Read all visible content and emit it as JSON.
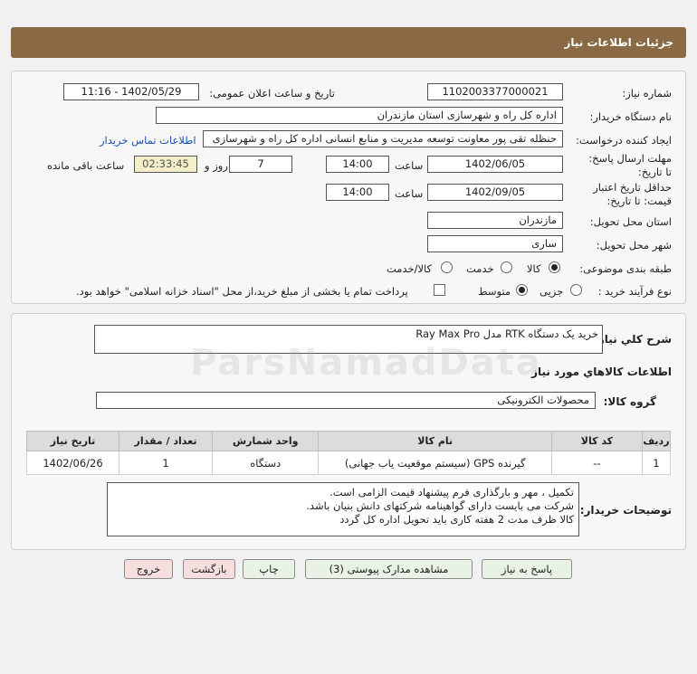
{
  "header": {
    "title": "جزئیات اطلاعات نیاز"
  },
  "form": {
    "need_number_label": "شماره نیاز:",
    "need_number": "1102003377000021",
    "announce_label": "تاریخ و ساعت اعلان عمومی:",
    "announce_value": "1402/05/29 - 11:16",
    "buyer_label": "نام دستگاه خریدار:",
    "buyer_value": "اداره کل راه و شهرسازی استان مازندران",
    "creator_label": "ایجاد کننده درخواست:",
    "creator_value": "حنظله تقی پور معاونت توسعه مدیریت و منابع انسانی اداره کل راه و شهرسازی",
    "contact_link": "اطلاعات تماس خریدار",
    "deadline_label": "مهلت ارسال پاسخ: تا تاریخ:",
    "deadline_date": "1402/06/05",
    "time_label": "ساعت",
    "deadline_time": "14:00",
    "days_value": "7",
    "days_label": "روز و",
    "remaining_time": "02:33:45",
    "remaining_label": "ساعت باقی مانده",
    "validity_label": "حداقل تاریخ اعتبار قیمت: تا تاریخ:",
    "validity_date": "1402/09/05",
    "validity_time": "14:00",
    "province_label": "استان محل تحویل:",
    "province_value": "مازندران",
    "city_label": "شهر محل تحویل:",
    "city_value": "ساری",
    "category_label": "طبقه بندی موضوعی:",
    "category_options": [
      "کالا",
      "خدمت",
      "کالا/خدمت"
    ],
    "category_selected": "کالا",
    "process_label": "نوع فرآیند خرید :",
    "process_options": [
      "جزیی",
      "متوسط"
    ],
    "process_selected": "متوسط",
    "payment_note": "پرداخت تمام یا بخشی از مبلغ خرید،از محل \"اسناد خزانه اسلامی\" خواهد بود."
  },
  "summary": {
    "title_label": "شرح کلي نياز:",
    "title_value": "خرید یک دستگاه  RTK  مدل Ray Max Pro",
    "goods_info_title": "اطلاعات کالاهاي مورد نياز",
    "group_label": "گروه کالا:",
    "group_value": "محصولات الکترونیکی"
  },
  "table": {
    "headers": [
      "ردیف",
      "کد کالا",
      "نام کالا",
      "واحد شمارش",
      "تعداد / مقدار",
      "تاریخ نیاز"
    ],
    "rows": [
      [
        "1",
        "--",
        "گیرنده GPS (سیستم موقعیت یاب جهانی)",
        "دستگاه",
        "1",
        "1402/06/26"
      ]
    ]
  },
  "notes": {
    "label": "توضیحات خریدار:",
    "lines": [
      "تکمیل ، مهر و بارگذاری فرم پیشنهاد قیمت الزامی است.",
      "شرکت می بایست دارای گواهینامه شرکتهای دانش بنیان باشد.",
      "کالا ظرف مدت 2 هفته کاری باید تحویل اداره کل گردد"
    ]
  },
  "buttons": {
    "reply": "پاسخ به نیاز",
    "attachments": "مشاهده مدارک پیوستی (3)",
    "print": "چاپ",
    "back": "بازگشت",
    "exit": "خروج"
  },
  "watermark": {
    "text": "ParsNamadData"
  }
}
